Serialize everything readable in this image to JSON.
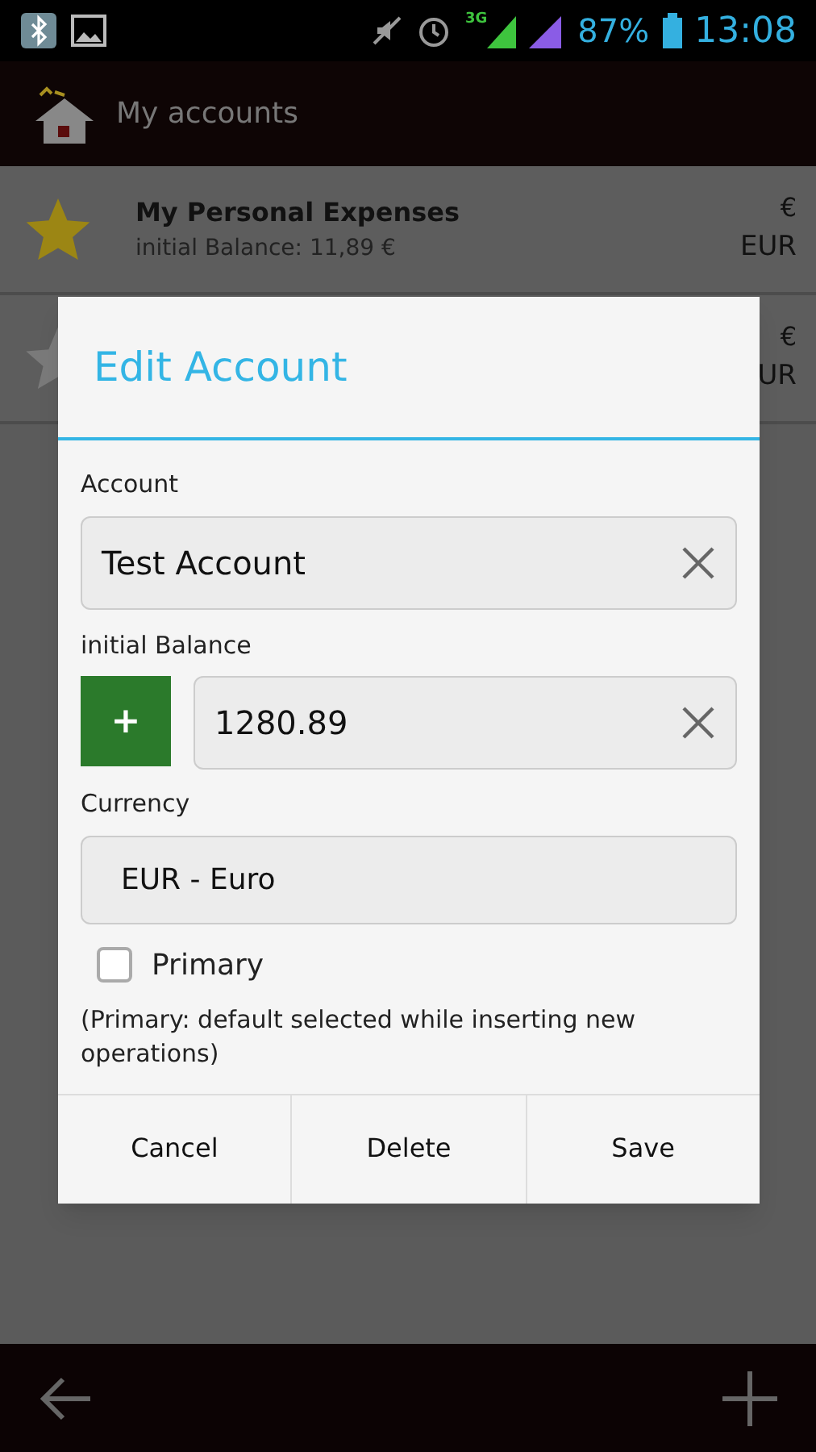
{
  "status_bar": {
    "network": "3G",
    "battery": "87%",
    "time": "13:08"
  },
  "action_bar": {
    "title": "My accounts"
  },
  "accounts": [
    {
      "name": "My Personal Expenses",
      "balance": "initial Balance: 11,89 €",
      "currency_symbol": "€",
      "currency_code": "EUR",
      "primary": true
    },
    {
      "currency_symbol": "€",
      "currency_code": "UR",
      "primary": false
    }
  ],
  "dialog": {
    "title": "Edit Account",
    "account": {
      "label": "Account",
      "value": "Test Account"
    },
    "balance": {
      "label": "initial Balance",
      "sign": "+",
      "value": "1280.89"
    },
    "currency": {
      "label": "Currency",
      "value": "EUR - Euro"
    },
    "primary": {
      "label": "Primary",
      "checked": false
    },
    "note": "(Primary: default selected while inserting new operations)",
    "buttons": [
      "Cancel",
      "Delete",
      "Save"
    ]
  }
}
